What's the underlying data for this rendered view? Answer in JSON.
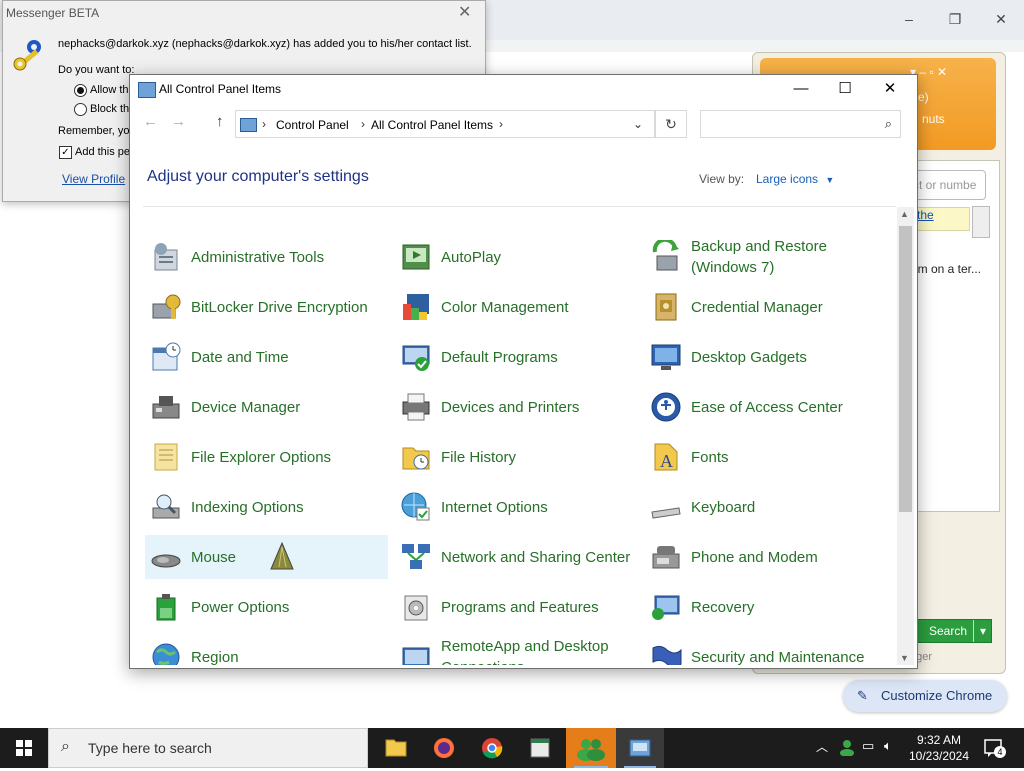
{
  "chrome": {
    "window_controls": [
      "–",
      "❐",
      "✕"
    ],
    "customize_label": "Customize Chrome"
  },
  "messenger_panel": {
    "header_line1": "me)",
    "header_line2": "nuts",
    "search_placeholder": "ct or numbe",
    "link_text": "the",
    "message_preview": "I'm on a ter...",
    "search_button": "Search",
    "footer_text": "nger"
  },
  "beta_dialog": {
    "title": "Messenger BETA",
    "message": "nephacks@darkok.xyz (nephacks@darkok.xyz) has added you to his/her contact list.",
    "do_you_want": "Do you want to:",
    "option_allow": "Allow thi",
    "option_block": "Block thi",
    "remember": "Remember, you",
    "add_checkbox": "Add this per",
    "view_profile": "View Profile"
  },
  "control_panel": {
    "title": "All Control Panel Items",
    "breadcrumb": [
      "Control Panel",
      "All Control Panel Items"
    ],
    "heading": "Adjust your computer's settings",
    "view_by_label": "View by:",
    "view_by_value": "Large icons",
    "items": [
      {
        "label": "Administrative Tools",
        "icon": "admin-tools-icon"
      },
      {
        "label": "AutoPlay",
        "icon": "autoplay-icon"
      },
      {
        "label": "Backup and Restore (Windows 7)",
        "icon": "backup-restore-icon"
      },
      {
        "label": "BitLocker Drive Encryption",
        "icon": "bitlocker-icon"
      },
      {
        "label": "Color Management",
        "icon": "color-management-icon"
      },
      {
        "label": "Credential Manager",
        "icon": "credential-manager-icon"
      },
      {
        "label": "Date and Time",
        "icon": "date-time-icon"
      },
      {
        "label": "Default Programs",
        "icon": "default-programs-icon"
      },
      {
        "label": "Desktop Gadgets",
        "icon": "desktop-gadgets-icon"
      },
      {
        "label": "Device Manager",
        "icon": "device-manager-icon"
      },
      {
        "label": "Devices and Printers",
        "icon": "devices-printers-icon"
      },
      {
        "label": "Ease of Access Center",
        "icon": "ease-of-access-icon"
      },
      {
        "label": "File Explorer Options",
        "icon": "file-explorer-options-icon"
      },
      {
        "label": "File History",
        "icon": "file-history-icon"
      },
      {
        "label": "Fonts",
        "icon": "fonts-icon"
      },
      {
        "label": "Indexing Options",
        "icon": "indexing-options-icon"
      },
      {
        "label": "Internet Options",
        "icon": "internet-options-icon"
      },
      {
        "label": "Keyboard",
        "icon": "keyboard-icon"
      },
      {
        "label": "Mouse",
        "icon": "mouse-icon"
      },
      {
        "label": "Network and Sharing Center",
        "icon": "network-sharing-icon"
      },
      {
        "label": "Phone and Modem",
        "icon": "phone-modem-icon"
      },
      {
        "label": "Power Options",
        "icon": "power-options-icon"
      },
      {
        "label": "Programs and Features",
        "icon": "programs-features-icon"
      },
      {
        "label": "Recovery",
        "icon": "recovery-icon"
      },
      {
        "label": "Region",
        "icon": "region-icon"
      },
      {
        "label": "RemoteApp and Desktop Connections",
        "icon": "remoteapp-icon"
      },
      {
        "label": "Security and Maintenance",
        "icon": "security-maintenance-icon"
      }
    ]
  },
  "taskbar": {
    "search_placeholder": "Type here to search",
    "time": "9:32 AM",
    "date": "10/23/2024",
    "notification_count": "4",
    "apps": [
      "file-explorer-icon",
      "firefox-icon",
      "chrome-icon",
      "notepad-app-icon",
      "messenger-icon",
      "control-panel-icon"
    ]
  }
}
